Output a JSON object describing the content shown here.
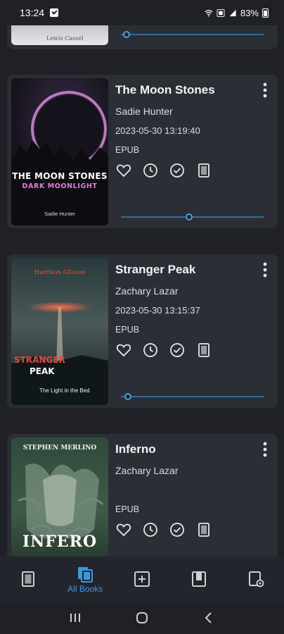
{
  "status_bar": {
    "time": "13:24",
    "battery": "83%"
  },
  "previous_book": {
    "cover_author": "Lewis Cassel",
    "progress_percent": 4
  },
  "books": [
    {
      "title": "The Moon Stones",
      "author": "Sadie Hunter",
      "date": "2023-05-30 13:19:40",
      "format": "EPUB",
      "cover": {
        "title": "THE MOON STONES",
        "subtitle": "DARK MOONLIGHT",
        "author": "Sadie Hunter"
      },
      "progress_percent": 48
    },
    {
      "title": "Stranger Peak",
      "author": "Zachary Lazar",
      "date": "2023-05-30 13:15:37",
      "format": "EPUB",
      "cover": {
        "author": "Harrison Glisson",
        "title_line1": "STRANGER",
        "title_line2": "PEAK",
        "tagline": "The Light in the Bed"
      },
      "progress_percent": 5
    },
    {
      "title": "Inferno",
      "author": "Zachary Lazar",
      "date": "",
      "format": "EPUB",
      "cover": {
        "author": "STEPHEN MERLINO",
        "title": "INFERO"
      }
    }
  ],
  "bottom_nav": {
    "active_label": "All Books"
  },
  "colors": {
    "accent": "#3b9be0",
    "card": "#2b2e35",
    "background": "#1f2126"
  }
}
